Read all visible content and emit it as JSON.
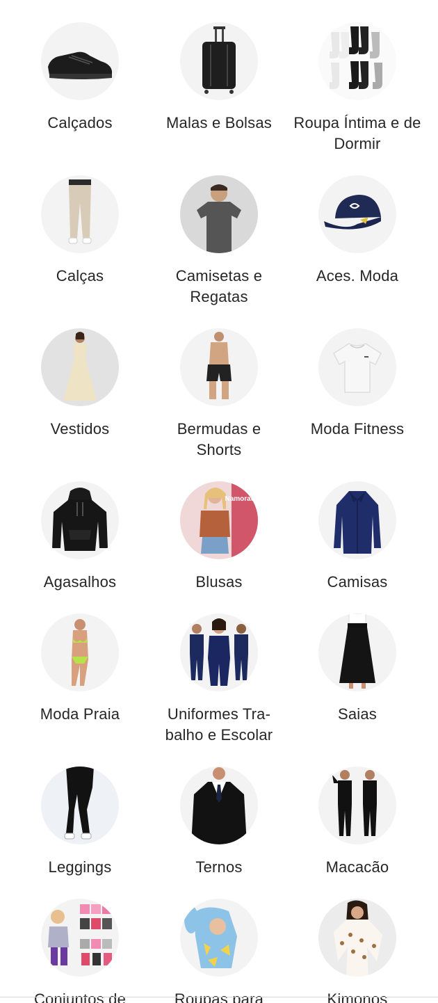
{
  "categories": [
    {
      "label": "Calçados",
      "icon": "sneaker-icon"
    },
    {
      "label": "Malas e Bolsas",
      "icon": "suitcase-icon"
    },
    {
      "label": "Roupa Íntima e de Dormir",
      "icon": "socks-icon"
    },
    {
      "label": "Calças",
      "icon": "pants-icon"
    },
    {
      "label": "Camisetas e Regatas",
      "icon": "tshirt-model-icon"
    },
    {
      "label": "Aces. Moda",
      "icon": "cap-icon"
    },
    {
      "label": "Vestidos",
      "icon": "dress-icon"
    },
    {
      "label": "Bermudas e Shorts",
      "icon": "shorts-icon"
    },
    {
      "label": "Moda Fitness",
      "icon": "white-tshirt-icon"
    },
    {
      "label": "Agasalhos",
      "icon": "hoodie-icon"
    },
    {
      "label": "Blusas",
      "icon": "blouse-icon"
    },
    {
      "label": "Camisas",
      "icon": "dress-shirt-icon"
    },
    {
      "label": "Moda Praia",
      "icon": "bikini-icon"
    },
    {
      "label": "Uniformes Tra-balho e Escolar",
      "icon": "uniform-icon"
    },
    {
      "label": "Saias",
      "icon": "skirt-icon"
    },
    {
      "label": "Leggings",
      "icon": "leggings-icon"
    },
    {
      "label": "Ternos",
      "icon": "suit-icon"
    },
    {
      "label": "Macacão",
      "icon": "jumpsuit-icon"
    },
    {
      "label": "Conjuntos de",
      "icon": "kids-set-icon"
    },
    {
      "label": "Roupas para",
      "icon": "baby-clothes-icon"
    },
    {
      "label": "Kimonos",
      "icon": "kimono-icon"
    }
  ],
  "blouse_promo_text": "Namorados"
}
